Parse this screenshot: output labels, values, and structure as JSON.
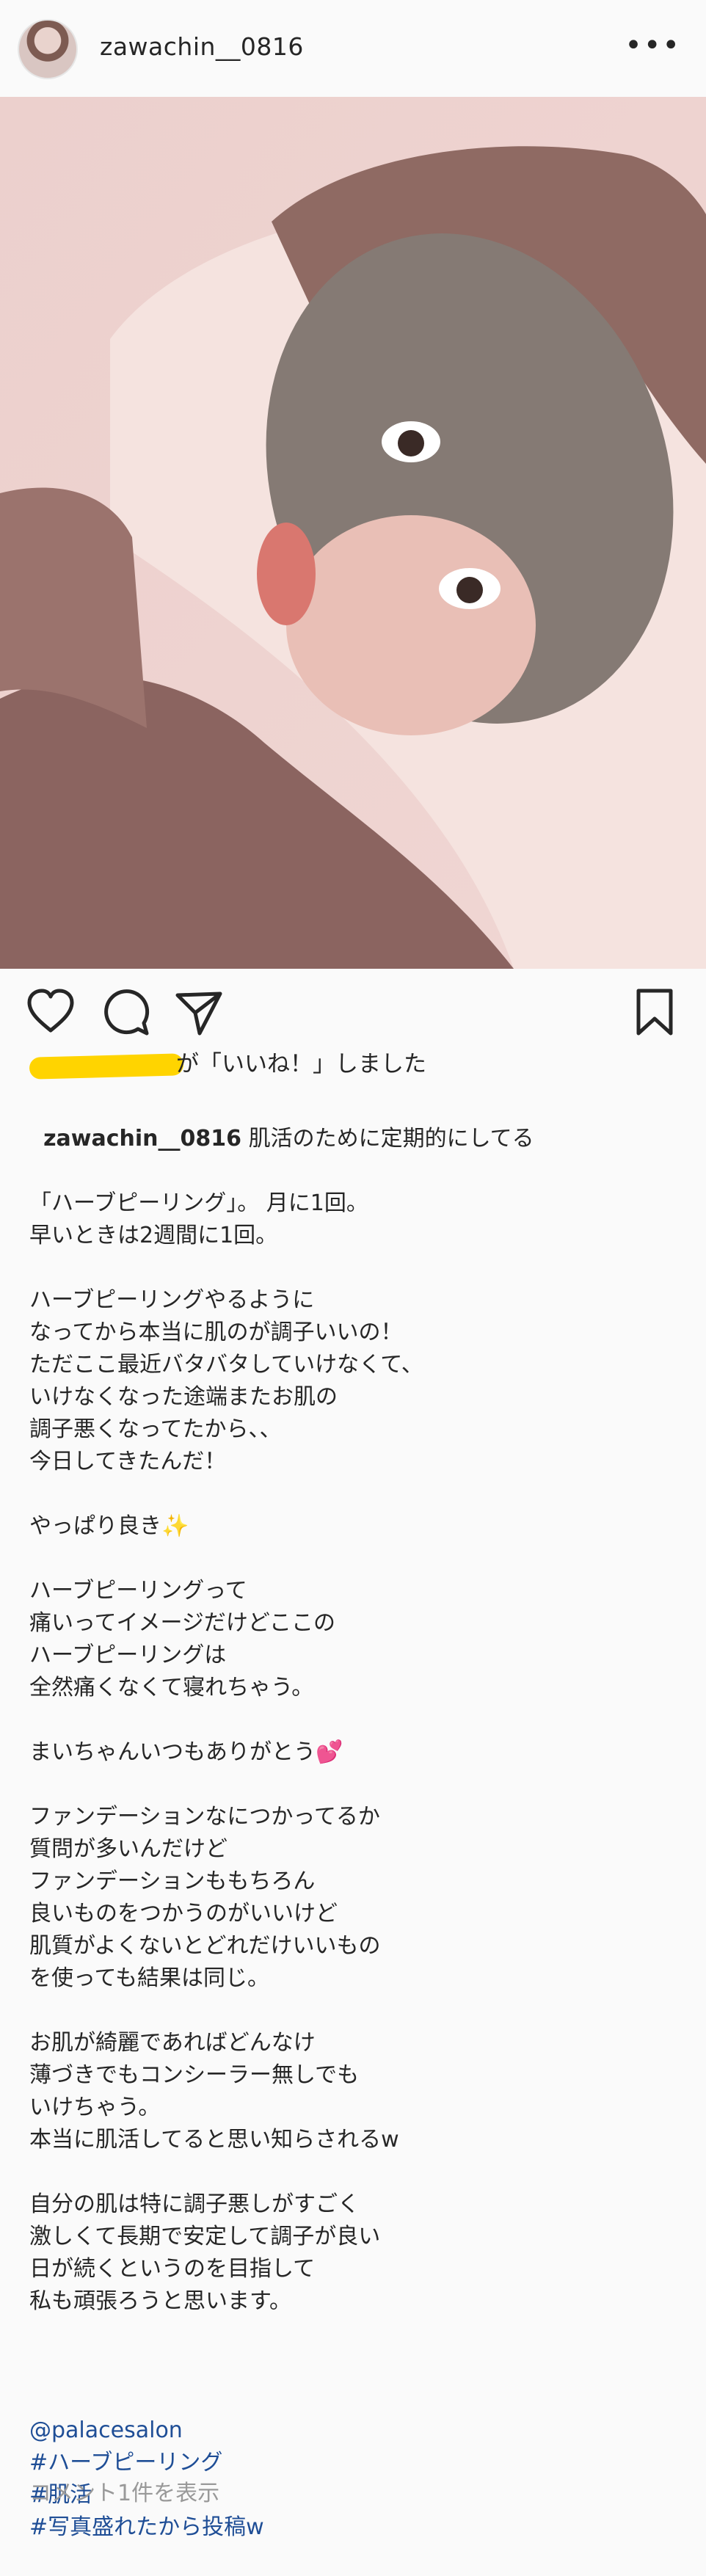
{
  "header": {
    "username": "zawachin__0816",
    "more": "•••"
  },
  "likes": {
    "text": "が「いいね！」しました"
  },
  "caption": {
    "username": "zawachin__0816",
    "first_line": "肌活のために定期的にしてる",
    "lines": [
      "「ハーブピーリング」。 月に1回。",
      "早いときは2週間に1回。",
      "",
      "ハーブピーリングやるように",
      "なってから本当に肌のが調子いいの！",
      "ただここ最近バタバタしていけなくて、",
      "いけなくなった途端またお肌の",
      "調子悪くなってたから、、",
      "今日してきたんだ！",
      "",
      "やっぱり良き✨",
      "",
      "ハーブピーリングって",
      "痛いってイメージだけどここの",
      "ハーブピーリングは",
      "全然痛くなくて寝れちゃう。",
      "",
      "まいちゃんいつもありがとう💕",
      "",
      "ファンデーションなにつかってるか",
      "質問が多いんだけど",
      "ファンデーションももちろん",
      "良いものをつかうのがいいけど",
      "肌質がよくないとどれだけいいもの",
      "を使っても結果は同じ。",
      "",
      "お肌が綺麗であればどんなけ",
      "薄づきでもコンシーラー無しでも",
      "いけちゃう。",
      "本当に肌活してると思い知らされるw",
      "",
      "自分の肌は特に調子悪しがすごく",
      "激しくて長期で安定して調子が良い",
      "日が続くというのを目指して",
      "私も頑張ろうと思います。",
      ""
    ],
    "tags": [
      "@palacesalon",
      "#ハーブピーリング",
      "#肌活",
      "#写真盛れたから投稿w"
    ]
  },
  "comments": {
    "text": "コメント1件を表示"
  },
  "colors": {
    "link": "#1f4e96",
    "muted": "#999999",
    "redaction": "#ffd400"
  }
}
